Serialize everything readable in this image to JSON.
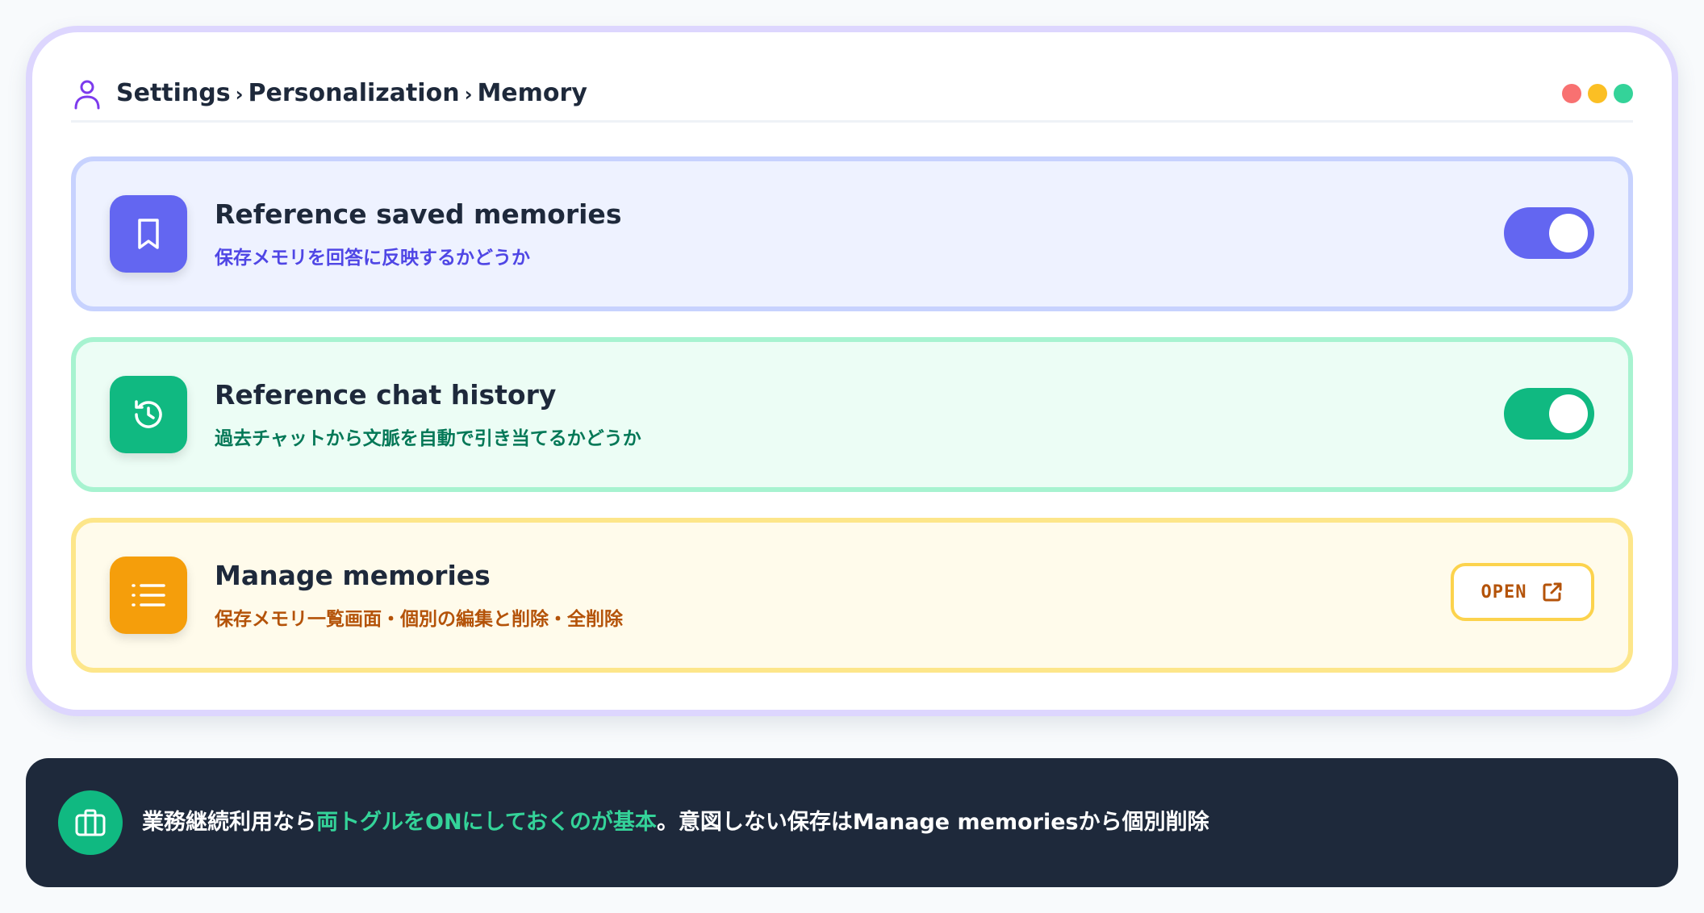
{
  "breadcrumb": {
    "items": [
      "Settings",
      "Personalization",
      "Memory"
    ],
    "separator": "›"
  },
  "window_dots": [
    "#f87171",
    "#fbbf24",
    "#34d399"
  ],
  "settings": [
    {
      "id": "saved-memories",
      "icon": "bookmark-icon",
      "title": "Reference saved memories",
      "subtitle": "保存メモリを回答に反映するかどうか",
      "control": "toggle",
      "enabled": true,
      "accent": "#6366f1",
      "bg": "#eef2ff",
      "border": "#c7d2fe",
      "subtitle_color": "#4f46e5"
    },
    {
      "id": "chat-history",
      "icon": "history-icon",
      "title": "Reference chat history",
      "subtitle": "過去チャットから文脈を自動で引き当てるかどうか",
      "control": "toggle",
      "enabled": true,
      "accent": "#10b981",
      "bg": "#ecfdf5",
      "border": "#a7f3d0",
      "subtitle_color": "#047857"
    },
    {
      "id": "manage-memories",
      "icon": "list-icon",
      "title": "Manage memories",
      "subtitle": "保存メモリ一覧画面・個別の編集と削除・全削除",
      "control": "button",
      "button_label": "OPEN",
      "button_icon": "external-link-icon",
      "accent": "#f59e0b",
      "bg": "#fffbeb",
      "border": "#fde68a",
      "subtitle_color": "#b45309"
    }
  ],
  "banner": {
    "icon": "briefcase-icon",
    "text_before": "業務継続利用なら",
    "text_highlight": "両トグルをONにしておくのが基本",
    "text_after": "。意図しない保存はManage memoriesから個別削除"
  }
}
